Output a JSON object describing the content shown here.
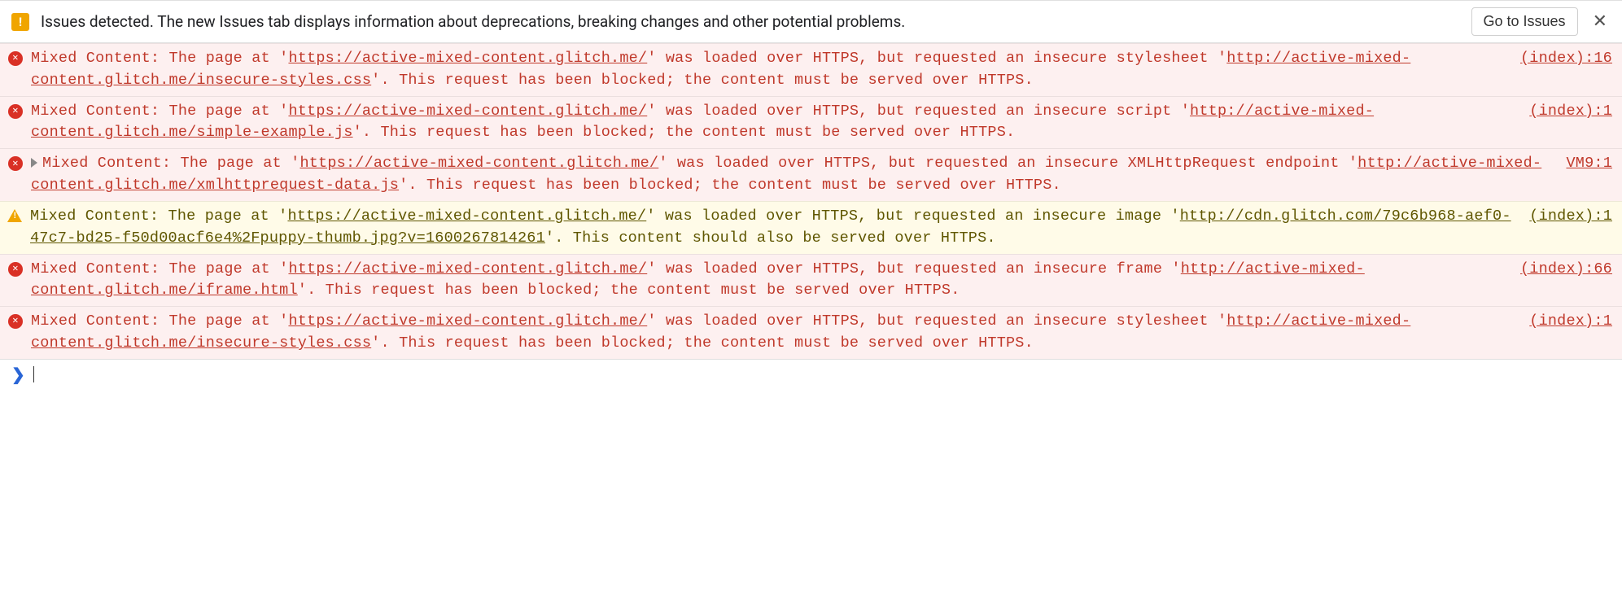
{
  "issues_bar": {
    "icon": "issues-warning-icon",
    "text": "Issues detected. The new Issues tab displays information about deprecations, breaking changes and other potential problems.",
    "button": "Go to Issues",
    "close": "✕"
  },
  "console": [
    {
      "level": "error",
      "expandable": false,
      "prefix": "Mixed Content: The page at '",
      "page_url": "https://active-mixed-content.glitch.me/",
      "mid1": "' was loaded over HTTPS, but requested an insecure stylesheet '",
      "res_url": "http://active-mixed-content.glitch.me/insecure-styles.css",
      "suffix": "'. This request has been blocked; the content must be served over HTTPS.",
      "source": "(index):16"
    },
    {
      "level": "error",
      "expandable": false,
      "prefix": "Mixed Content: The page at '",
      "page_url": "https://active-mixed-content.glitch.me/",
      "mid1": "' was loaded over HTTPS, but requested an insecure script '",
      "res_url": "http://active-mixed-content.glitch.me/simple-example.js",
      "suffix": "'. This request has been blocked; the content must be served over HTTPS.",
      "source": "(index):1"
    },
    {
      "level": "error",
      "expandable": true,
      "prefix": "Mixed Content: The page at '",
      "page_url": "https://active-mixed-content.glitch.me/",
      "mid1": "' was loaded over HTTPS, but requested an insecure XMLHttpRequest endpoint '",
      "res_url": "http://active-mixed-content.glitch.me/xmlhttprequest-data.js",
      "suffix": "'. This request has been blocked; the content must be served over HTTPS.",
      "source": "VM9:1"
    },
    {
      "level": "warning",
      "expandable": false,
      "prefix": "Mixed Content: The page at '",
      "page_url": "https://active-mixed-content.glitch.me/",
      "mid1": "' was loaded over HTTPS, but requested an insecure image '",
      "res_url": "http://cdn.glitch.com/79c6b968-aef0-47c7-bd25-f50d00acf6e4%2Fpuppy-thumb.jpg?v=1600267814261",
      "suffix": "'. This content should also be served over HTTPS.",
      "source": "(index):1"
    },
    {
      "level": "error",
      "expandable": false,
      "prefix": "Mixed Content: The page at '",
      "page_url": "https://active-mixed-content.glitch.me/",
      "mid1": "' was loaded over HTTPS, but requested an insecure frame '",
      "res_url": "http://active-mixed-content.glitch.me/iframe.html",
      "suffix": "'. This request has been blocked; the content must be served over HTTPS.",
      "source": "(index):66"
    },
    {
      "level": "error",
      "expandable": false,
      "prefix": "Mixed Content: The page at '",
      "page_url": "https://active-mixed-content.glitch.me/",
      "mid1": "' was loaded over HTTPS, but requested an insecure stylesheet '",
      "res_url": "http://active-mixed-content.glitch.me/insecure-styles.css",
      "suffix": "'. This request has been blocked; the content must be served over HTTPS.",
      "source": "(index):1"
    }
  ],
  "prompt": {
    "chevron": "❯",
    "value": ""
  }
}
